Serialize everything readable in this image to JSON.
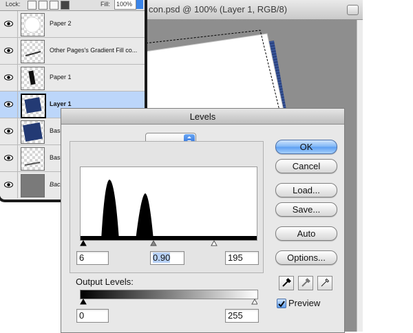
{
  "document": {
    "title": "con.psd @ 100% (Layer 1, RGB/8)"
  },
  "layers_panel": {
    "lock_label": "Lock:",
    "fill_label": "Fill:",
    "fill_value": "100%",
    "layers": [
      {
        "name": "Paper 2",
        "selected": false
      },
      {
        "name": "Other Pages's Gradient Fill co...",
        "selected": false
      },
      {
        "name": "Paper 1",
        "selected": false
      },
      {
        "name": "Layer 1",
        "selected": true
      },
      {
        "name": "Base's Color Fill",
        "selected": false
      },
      {
        "name": "Base Side's Color Fill",
        "selected": false
      },
      {
        "name": "Background",
        "selected": false
      }
    ]
  },
  "levels": {
    "title": "Levels",
    "input_black": "6",
    "input_mid": "0.90",
    "input_white": "195",
    "output_label": "Output Levels:",
    "output_black": "0",
    "output_white": "255",
    "buttons": {
      "ok": "OK",
      "cancel": "Cancel",
      "load": "Load...",
      "save": "Save...",
      "auto": "Auto",
      "options": "Options..."
    },
    "preview_label": "Preview",
    "preview_checked": true
  },
  "colors": {
    "accent_blue": "#5c9ef2",
    "selection_row": "#bcd6fa",
    "icon_navy": "#233a74"
  }
}
